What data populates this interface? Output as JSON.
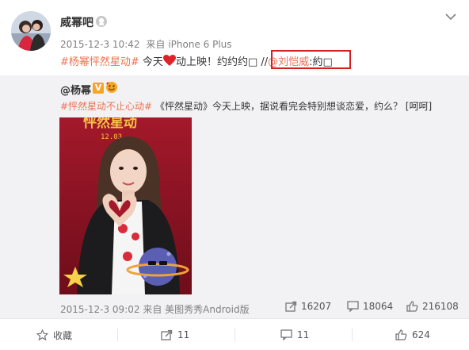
{
  "post": {
    "username": "威幂吧",
    "time": "2015-12-3 10:42",
    "source_prefix": "来自",
    "source": "iPhone 6 Plus",
    "text": {
      "topic": "#杨幂怦然星动#",
      "part1": " 今天",
      "part2": "动上映！约约约□ //",
      "mention": "@刘恺威",
      "part3": ":約□"
    }
  },
  "repost": {
    "username": "@杨幂",
    "topic": "#怦然星动不止心动#",
    "text": " 《怦然星动》今天上映，据说看完会特别想谈恋爱，约么？ [呵呵]",
    "photo_caption": "怦然星动",
    "photo_date": "12.03",
    "time": "2015-12-3 09:02",
    "source_prefix": "来自",
    "source": "美图秀秀Android版",
    "reposts": "16207",
    "comments": "18064",
    "likes": "216108"
  },
  "actions": {
    "collect": "收藏",
    "repost": "11",
    "comment": "11",
    "like": "624"
  },
  "colors": {
    "link": "#eb7350",
    "highlight_border": "#d42020",
    "repost_bg": "#f2f2f5"
  }
}
